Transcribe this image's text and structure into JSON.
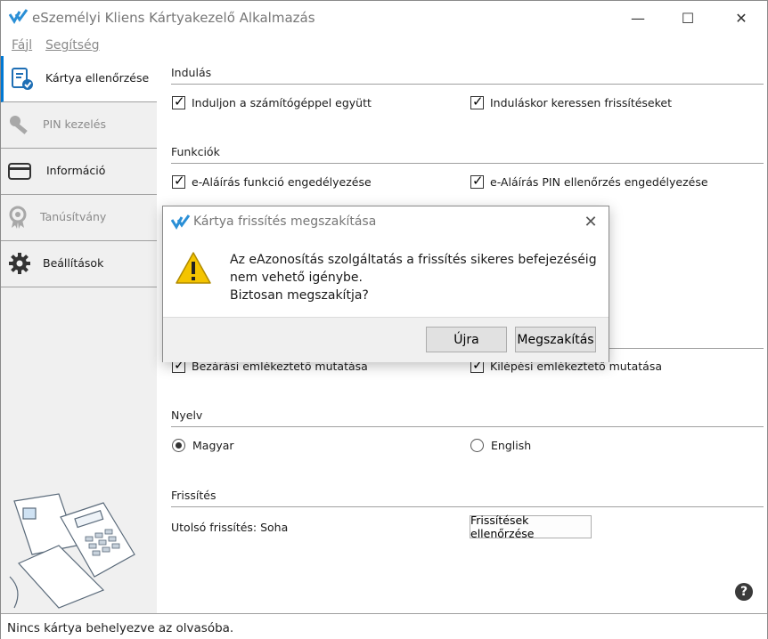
{
  "window": {
    "title": "eSzemélyi Kliens Kártyakezelő Alkalmazás",
    "controls": {
      "minimize": "—",
      "maximize": "☐",
      "close": "✕"
    }
  },
  "menu": {
    "file": "Fájl",
    "help": "Segítség"
  },
  "sidebar": {
    "items": [
      {
        "label": "Kártya ellenőrzése",
        "icon": "card-check-icon",
        "active": true
      },
      {
        "label": "PIN kezelés",
        "icon": "key-icon",
        "disabled": true
      },
      {
        "label": "Információ",
        "icon": "card-icon"
      },
      {
        "label": "Tanúsítvány",
        "icon": "certificate-icon",
        "disabled": true
      },
      {
        "label": "Beállítások",
        "icon": "gear-icon"
      }
    ]
  },
  "settings": {
    "startup": {
      "title": "Indulás",
      "opt1": {
        "label": "Induljon a számítógéppel együtt",
        "checked": true
      },
      "opt2": {
        "label": "Induláskor keressen frissítéseket",
        "checked": true
      }
    },
    "functions": {
      "title": "Funkciók",
      "opt1": {
        "label": "e-Aláírás funkció engedélyezése",
        "checked": true
      },
      "opt2": {
        "label": "e-Aláírás PIN ellenőrzés engedélyezése",
        "checked": true
      }
    },
    "reminders": {
      "opt1": {
        "label": "Bezárási emlékeztető mutatása",
        "checked": true
      },
      "opt2": {
        "label": "Kilépési emlékeztető mutatása",
        "checked": true
      }
    },
    "language": {
      "title": "Nyelv",
      "opt1": {
        "label": "Magyar",
        "selected": true
      },
      "opt2": {
        "label": "English",
        "selected": false
      }
    },
    "updates": {
      "title": "Frissítés",
      "last_update": "Utolsó frissítés: Soha",
      "check_button": "Frissítések ellenőrzése"
    },
    "help": "?"
  },
  "dialog": {
    "title": "Kártya frissítés megszakítása",
    "close": "✕",
    "line1": "Az eAzonosítás szolgáltatás a frissítés sikeres befejezéséig",
    "line2": "nem vehető igénybe.",
    "line3": "Biztosan megszakítja?",
    "retry_button": "Újra",
    "cancel_button": "Megszakítás"
  },
  "status": {
    "text": "Nincs kártya behelyezve az olvasóba."
  },
  "colors": {
    "accent": "#0078d4",
    "logo": "#2a8fd6",
    "warning": "#f4c400"
  }
}
